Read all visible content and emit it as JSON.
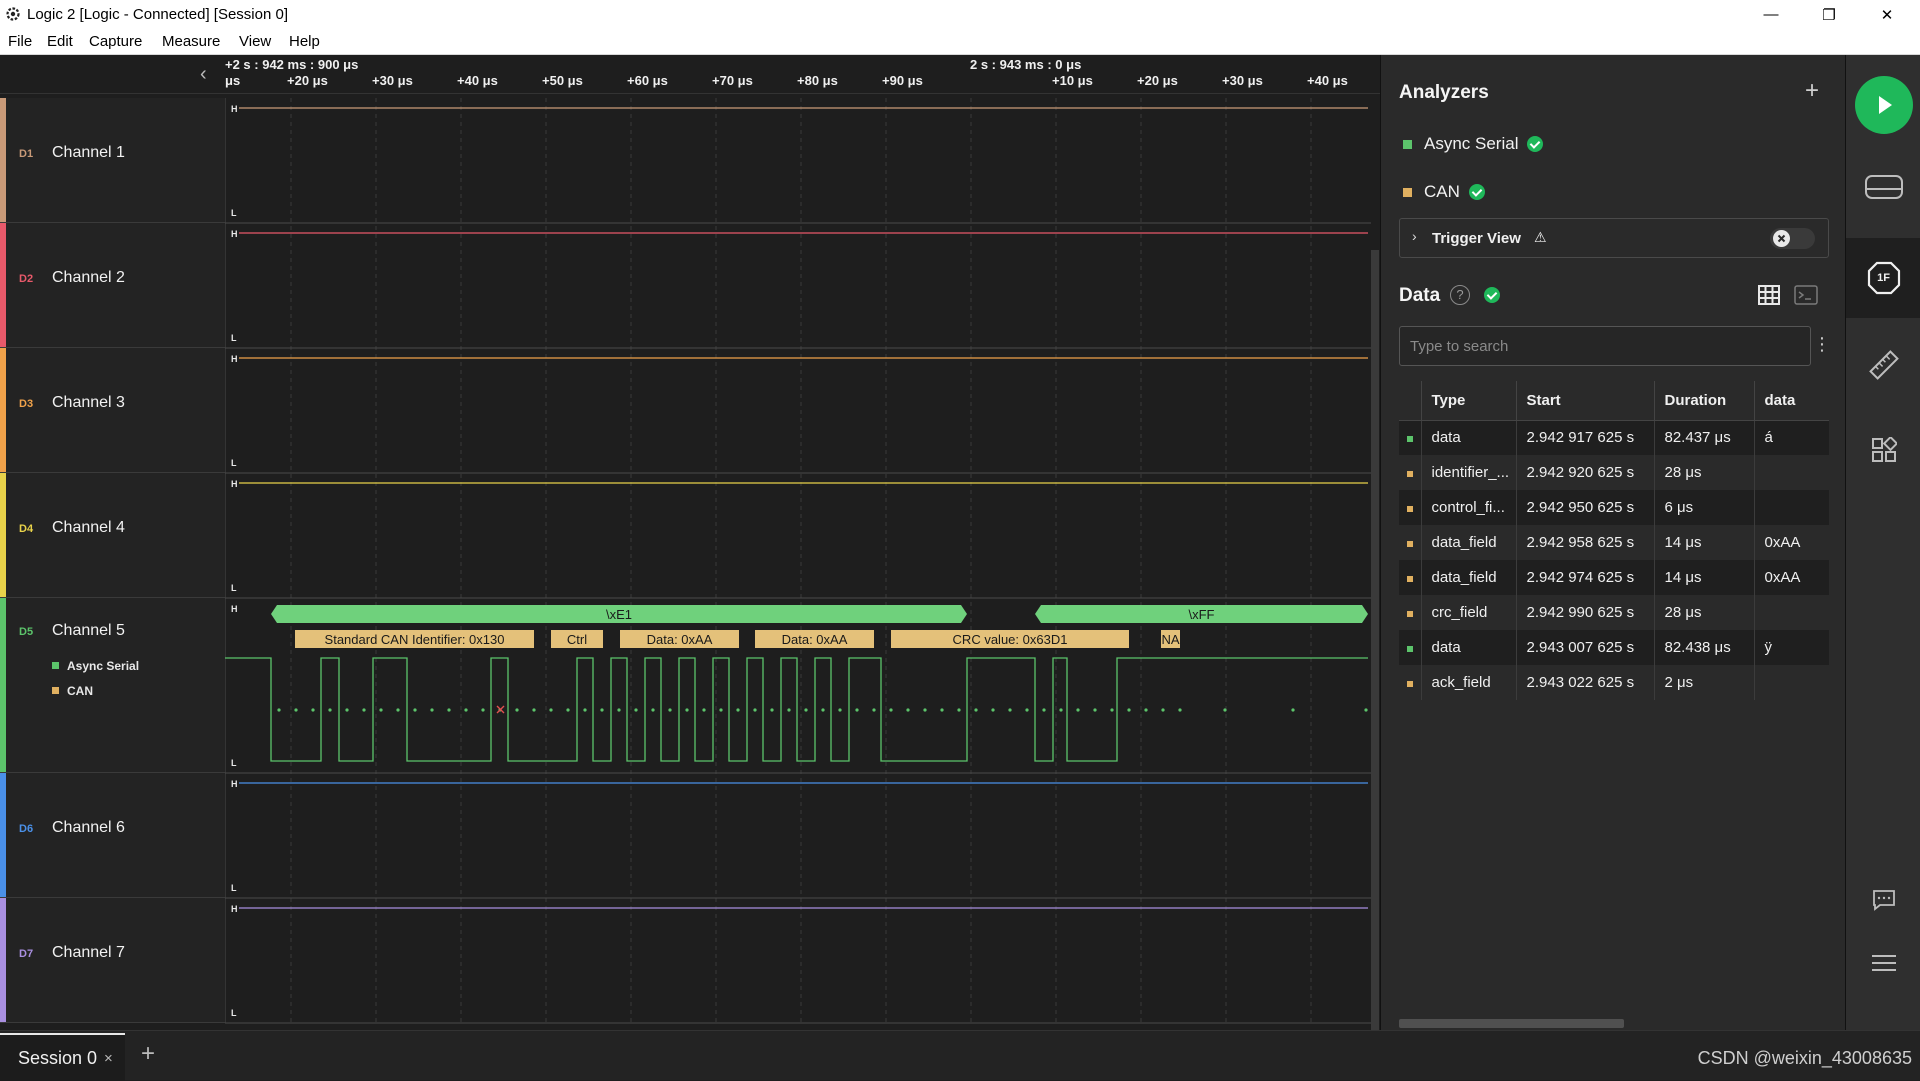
{
  "window": {
    "title": "Logic 2 [Logic - Connected] [Session 0]",
    "min_glyph": "—",
    "max_glyph": "❐",
    "close_glyph": "✕"
  },
  "menu": [
    "File",
    "Edit",
    "Capture",
    "Measure",
    "View",
    "Help"
  ],
  "ruler": {
    "left_time": "+2 s : 942 ms : 900 μs",
    "left_tick_fragment": "μs",
    "mid_time": "2 s : 943 ms : 0 μs",
    "ticks": [
      "+20 μs",
      "+30 μs",
      "+40 μs",
      "+50 μs",
      "+60 μs",
      "+70 μs",
      "+80 μs",
      "+90 μs",
      "+10 μs",
      "+20 μs",
      "+30 μs",
      "+40 μs"
    ],
    "collapse_glyph": "‹"
  },
  "channels": [
    {
      "id": "D1",
      "name": "Channel 1",
      "color": "#c99a78"
    },
    {
      "id": "D2",
      "name": "Channel 2",
      "color": "#e8596a"
    },
    {
      "id": "D3",
      "name": "Channel 3",
      "color": "#f0a24a"
    },
    {
      "id": "D4",
      "name": "Channel 4",
      "color": "#e8d24a"
    },
    {
      "id": "D5",
      "name": "Channel 5",
      "color": "#5cc46b",
      "analyzers": [
        {
          "name": "Async Serial",
          "color": "#5cc46b"
        },
        {
          "name": "CAN",
          "color": "#e0b060"
        }
      ]
    },
    {
      "id": "D6",
      "name": "Channel 6",
      "color": "#4a90e8"
    },
    {
      "id": "D7",
      "name": "Channel 7",
      "color": "#a98fe0"
    }
  ],
  "level_labels": {
    "high": "H",
    "low": "L"
  },
  "waveform": {
    "serial_bubbles": [
      "\\xE1",
      "\\xFF"
    ],
    "can_bubbles": [
      "Standard CAN Identifier: 0x130",
      "Ctrl",
      "Data: 0xAA",
      "Data: 0xAA",
      "CRC value: 0x63D1",
      "NA"
    ]
  },
  "panel": {
    "analyzers_title": "Analyzers",
    "add_glyph": "+",
    "analyzers": [
      {
        "name": "Async Serial",
        "color": "#5cc46b"
      },
      {
        "name": "CAN",
        "color": "#e0b060"
      }
    ],
    "trigger_label": "Trigger View",
    "trigger_warning_glyph": "⚠",
    "data_title": "Data",
    "help_glyph": "?",
    "search_placeholder": "Type to search",
    "more_glyph": "⋮",
    "table": {
      "headers": [
        "Type",
        "Start",
        "Duration",
        "data"
      ],
      "rows": [
        {
          "marker": "#5cc46b",
          "type": "data",
          "start": "2.942 917 625 s",
          "duration": "82.437 μs",
          "data": "á"
        },
        {
          "marker": "#e0b060",
          "type": "identifier_...",
          "start": "2.942 920 625 s",
          "duration": "28 μs",
          "data": ""
        },
        {
          "marker": "#e0b060",
          "type": "control_fi...",
          "start": "2.942 950 625 s",
          "duration": "6 μs",
          "data": ""
        },
        {
          "marker": "#e0b060",
          "type": "data_field",
          "start": "2.942 958 625 s",
          "duration": "14 μs",
          "data": "0xAA"
        },
        {
          "marker": "#e0b060",
          "type": "data_field",
          "start": "2.942 974 625 s",
          "duration": "14 μs",
          "data": "0xAA"
        },
        {
          "marker": "#e0b060",
          "type": "crc_field",
          "start": "2.942 990 625 s",
          "duration": "28 μs",
          "data": ""
        },
        {
          "marker": "#5cc46b",
          "type": "data",
          "start": "2.943 007 625 s",
          "duration": "82.438 μs",
          "data": "ÿ"
        },
        {
          "marker": "#e0b060",
          "type": "ack_field",
          "start": "2.943 022 625 s",
          "duration": "2 μs",
          "data": ""
        }
      ]
    }
  },
  "sidebar": {
    "active_badge": "1F"
  },
  "status": {
    "tab_label": "Session 0",
    "tab_close": "×",
    "new_tab": "+",
    "watermark": "CSDN @weixin_43008635"
  },
  "colors": {
    "accent_green": "#1fb85a",
    "serial_bubble": "#6fd17c",
    "can_bubble": "#e4c17a"
  }
}
